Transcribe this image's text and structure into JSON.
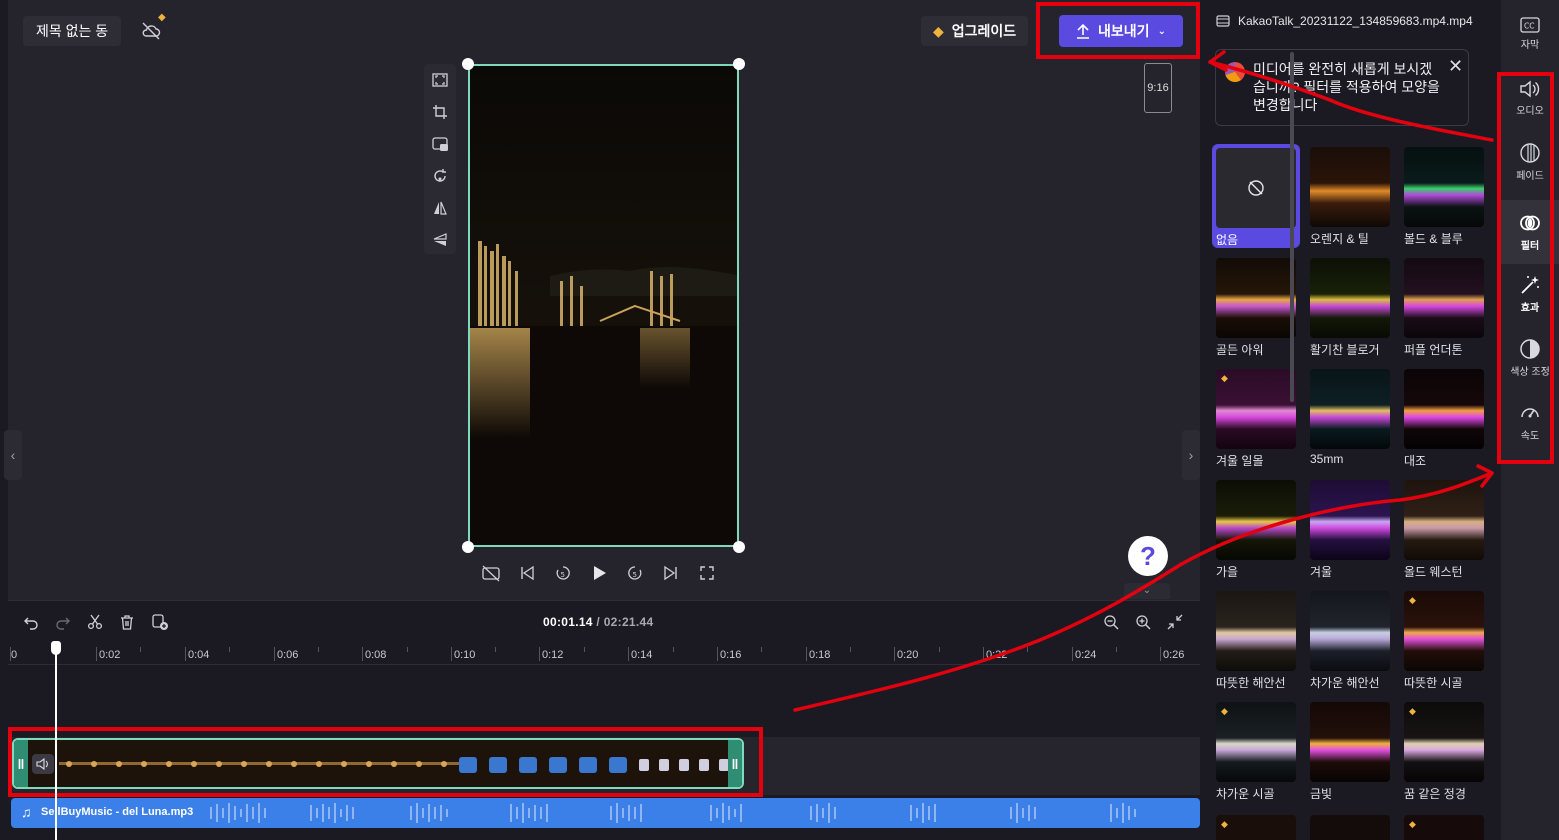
{
  "header": {
    "project_title": "제목 없는 동",
    "upgrade_label": "업그레이드",
    "export_label": "내보내기"
  },
  "preview": {
    "aspect_ratio": "9:16",
    "help_label": "?"
  },
  "timeline": {
    "current_time": "00:01.14",
    "separator": "/",
    "total_time": "02:21.44",
    "ruler_ticks": [
      "0",
      "0:02",
      "0:04",
      "0:06",
      "0:08",
      "0:10",
      "0:12",
      "0:14",
      "0:16",
      "0:18",
      "0:20",
      "0:22",
      "0:24",
      "0:26"
    ],
    "audio_clip_name": "SellBuyMusic - del Luna.mp3"
  },
  "panel": {
    "file_name": "KakaoTalk_20231122_134859683.mp4.mp4",
    "tip_text": "미디어를 완전히 새롭게 보시겠습니까? 필터를 적용하여 모양을 변경합니다",
    "filters": [
      {
        "label": "없음",
        "premium": false,
        "selected": true
      },
      {
        "label": "오렌지 & 틸",
        "premium": false
      },
      {
        "label": "볼드 & 블루",
        "premium": false
      },
      {
        "label": "골든 아워",
        "premium": false
      },
      {
        "label": "활기찬 블로거",
        "premium": false
      },
      {
        "label": "퍼플 언더톤",
        "premium": false
      },
      {
        "label": "겨울 일몰",
        "premium": true
      },
      {
        "label": "35mm",
        "premium": false
      },
      {
        "label": "대조",
        "premium": false
      },
      {
        "label": "가을",
        "premium": false
      },
      {
        "label": "겨울",
        "premium": false
      },
      {
        "label": "올드 웨스턴",
        "premium": false
      },
      {
        "label": "따뜻한 해안선",
        "premium": false
      },
      {
        "label": "차가운 해안선",
        "premium": false
      },
      {
        "label": "따뜻한 시골",
        "premium": true
      },
      {
        "label": "차가운 시골",
        "premium": true
      },
      {
        "label": "금빛",
        "premium": false
      },
      {
        "label": "꿈 같은 정경",
        "premium": true
      }
    ]
  },
  "rail": {
    "items": [
      {
        "label": "자막",
        "icon": "captions-icon"
      },
      {
        "label": "오디오",
        "icon": "speaker-icon"
      },
      {
        "label": "페이드",
        "icon": "fade-icon"
      },
      {
        "label": "필터",
        "icon": "filter-icon",
        "active": true
      },
      {
        "label": "효과",
        "icon": "magic-wand-icon"
      },
      {
        "label": "색상 조정",
        "icon": "color-adjust-icon"
      },
      {
        "label": "속도",
        "icon": "speed-icon"
      }
    ]
  },
  "colors": {
    "accent": "#5a4ae0",
    "clip_border": "#7ddbbc",
    "audio_track": "#3b7fe8",
    "annotation_red": "#e3000f",
    "premium_gold": "#f0b43c"
  }
}
